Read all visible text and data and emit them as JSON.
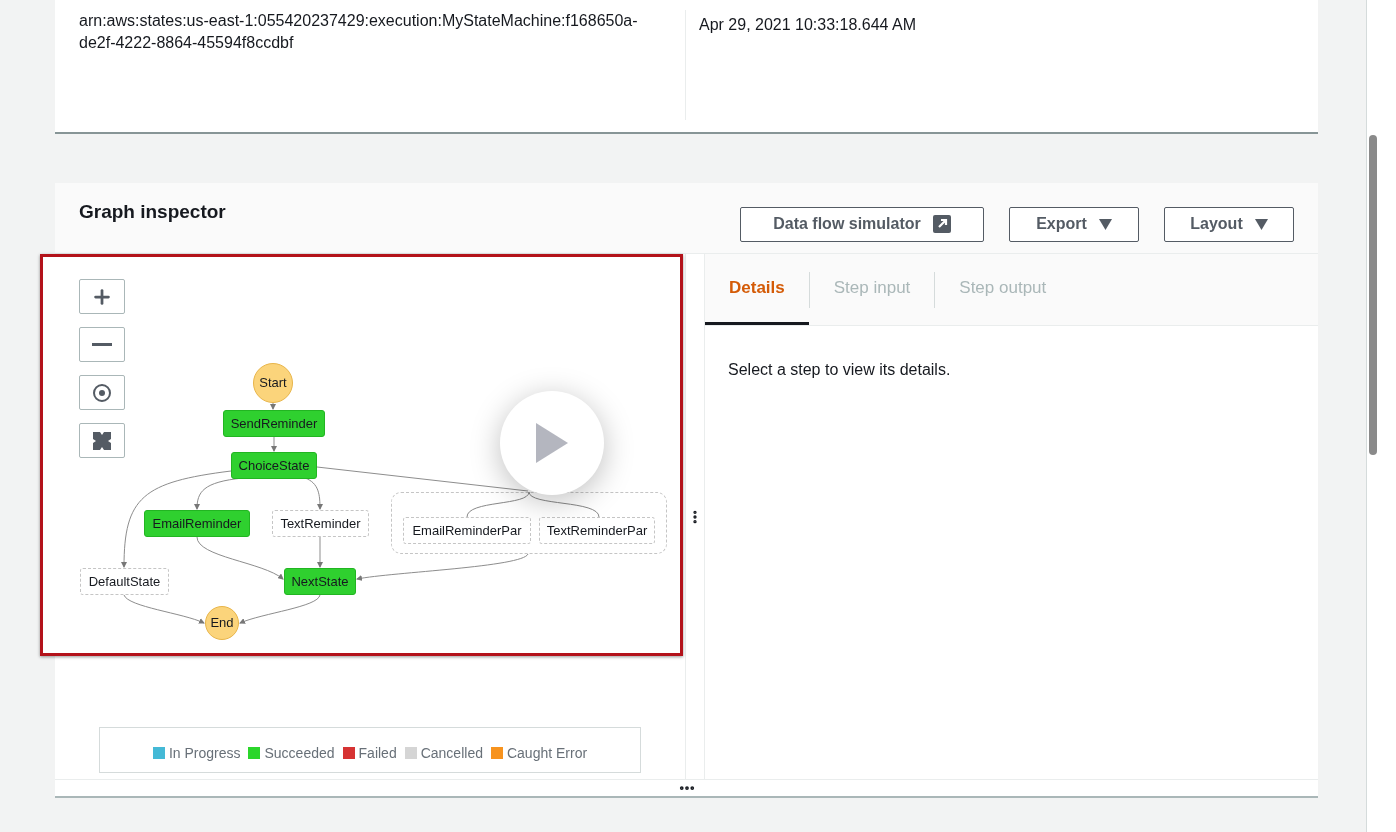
{
  "execution": {
    "arn": "arn:aws:states:us-east-1:055420237429:execution:MyStateMachine:f168650a-de2f-4222-8864-45594f8ccdbf",
    "end_time": "Apr 29, 2021 10:33:18.644 AM"
  },
  "graph_inspector": {
    "title": "Graph inspector",
    "buttons": [
      {
        "label": "Data flow simulator",
        "kind": "external"
      },
      {
        "label": "Export",
        "kind": "dropdown"
      },
      {
        "label": "Layout",
        "kind": "dropdown"
      }
    ],
    "nodes": [
      {
        "label": "Start",
        "kind": "terminal",
        "succeeded": true
      },
      {
        "label": "SendReminder",
        "kind": "task",
        "succeeded": true
      },
      {
        "label": "ChoiceState",
        "kind": "task",
        "succeeded": true
      },
      {
        "label": "EmailReminder",
        "kind": "task",
        "succeeded": true
      },
      {
        "label": "TextReminder",
        "kind": "task",
        "succeeded": false
      },
      {
        "kind": "parallel",
        "succeeded": false,
        "children": [
          {
            "label": "EmailReminderPar",
            "kind": "task",
            "succeeded": false
          },
          {
            "label": "TextReminderPar",
            "kind": "task",
            "succeeded": false
          }
        ]
      },
      {
        "label": "DefaultState",
        "kind": "task",
        "succeeded": false
      },
      {
        "label": "NextState",
        "kind": "task",
        "succeeded": true
      },
      {
        "label": "End",
        "kind": "terminal",
        "succeeded": true
      }
    ],
    "legend": [
      {
        "label": "In Progress",
        "color": "#44b9d6"
      },
      {
        "label": "Succeeded",
        "color": "#2bd62b"
      },
      {
        "label": "Failed",
        "color": "#d63333"
      },
      {
        "label": "Cancelled",
        "color": "#d5d5d5"
      },
      {
        "label": "Caught Error",
        "color": "#f7931e"
      }
    ],
    "tabs": [
      {
        "label": "Details",
        "selected": true
      },
      {
        "label": "Step input",
        "selected": false
      },
      {
        "label": "Step output",
        "selected": false
      }
    ],
    "details_message": "Select a step to view its details."
  }
}
